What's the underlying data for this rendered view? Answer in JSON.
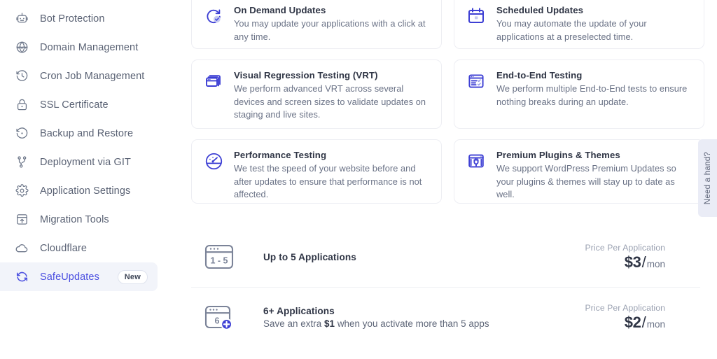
{
  "sidebar": {
    "items": [
      {
        "label": "Bot Protection",
        "icon": "bot-icon",
        "active": false
      },
      {
        "label": "Domain Management",
        "icon": "globe-www-icon",
        "active": false
      },
      {
        "label": "Cron Job Management",
        "icon": "clock-history-icon",
        "active": false
      },
      {
        "label": "SSL Certificate",
        "icon": "lock-icon",
        "active": false
      },
      {
        "label": "Backup and Restore",
        "icon": "restore-icon",
        "active": false
      },
      {
        "label": "Deployment via GIT",
        "icon": "git-branch-icon",
        "active": false
      },
      {
        "label": "Application Settings",
        "icon": "gear-icon",
        "active": false
      },
      {
        "label": "Migration Tools",
        "icon": "migration-upload-icon",
        "active": false
      },
      {
        "label": "Cloudflare",
        "icon": "cloud-icon",
        "active": false
      },
      {
        "label": "SafeUpdates",
        "icon": "safeupdates-refresh-icon",
        "active": true,
        "badge": "New"
      }
    ]
  },
  "features": [
    {
      "title": "On Demand Updates",
      "desc": "You may update your applications with a click at any time.",
      "icon": "refresh-check-icon"
    },
    {
      "title": "Scheduled Updates",
      "desc": "You may automate the update of your applications at a preselected time.",
      "icon": "calendar-icon"
    },
    {
      "title": "Visual Regression Testing (VRT)",
      "desc": "We perform advanced VRT across several devices and screen sizes to validate updates on staging and live sites.",
      "icon": "browser-windows-icon"
    },
    {
      "title": "End-to-End Testing",
      "desc": "We perform multiple End-to-End tests to ensure nothing breaks during an update.",
      "icon": "checklist-browser-icon"
    },
    {
      "title": "Performance Testing",
      "desc": "We test the speed of your website before and after updates to ensure that performance is not affected.",
      "icon": "speedometer-icon"
    },
    {
      "title": "Premium Plugins & Themes",
      "desc": "We support WordPress Premium Updates so your plugins & themes will stay up to date as well.",
      "icon": "plugin-browser-icon"
    }
  ],
  "pricing": {
    "rows": [
      {
        "icon": "browser-range-icon",
        "icon_text": "1 - 5",
        "name": "Up to 5 Applications",
        "sub_before": "",
        "sub_bold": "",
        "sub_after": "",
        "price_label": "Price Per Application",
        "amount": "$3",
        "separator": "/",
        "period": "mon"
      },
      {
        "icon": "browser-plus-icon",
        "icon_text": "6",
        "name": "6+ Applications",
        "sub_before": "Save an extra ",
        "sub_bold": "$1",
        "sub_after": " when you activate more than 5 apps",
        "price_label": "Price Per Application",
        "amount": "$2",
        "separator": "/",
        "period": "mon"
      }
    ]
  },
  "support_tab": {
    "label": "Need a hand?"
  },
  "colors": {
    "accent": "#4a4ee0",
    "icon_blue": "#3d3fd4",
    "text_dark": "#2f3545",
    "text_muted": "#6a7286",
    "active_bg": "#f2f4fa",
    "card_border": "#edeef3",
    "support_bg": "#eaecf6"
  }
}
